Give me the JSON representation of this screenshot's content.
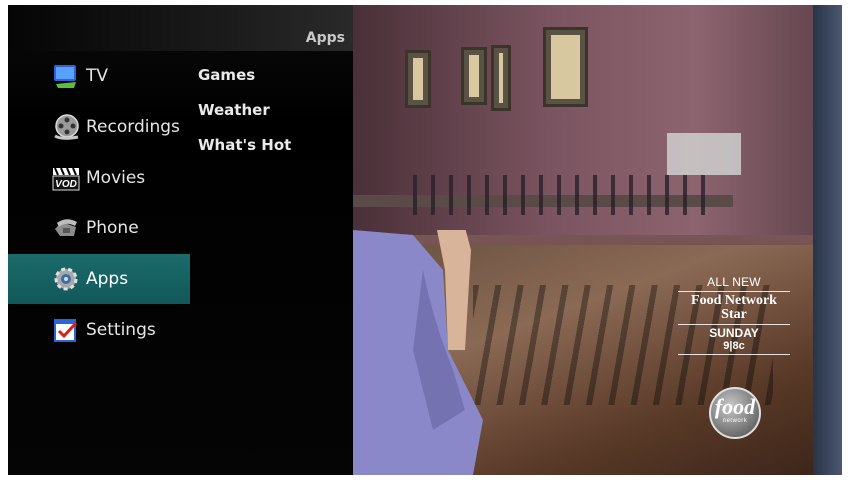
{
  "menu": {
    "section_title": "Apps",
    "items": [
      {
        "label": "TV",
        "icon": "tv-icon"
      },
      {
        "label": "Recordings",
        "icon": "film-reel-icon"
      },
      {
        "label": "Movies",
        "icon": "vod-clapper-icon"
      },
      {
        "label": "Phone",
        "icon": "phone-icon"
      },
      {
        "label": "Apps",
        "icon": "gear-icon",
        "selected": true
      },
      {
        "label": "Settings",
        "icon": "checklist-icon"
      }
    ],
    "submenu": [
      {
        "label": "Games"
      },
      {
        "label": "Weather"
      },
      {
        "label": "What's Hot"
      }
    ],
    "vod_badge": "VOD"
  },
  "promo": {
    "line1": "ALL NEW",
    "show_line1": "Food Network",
    "show_line2": "Star",
    "day": "SUNDAY",
    "time": "9|8c",
    "logo_main": "food",
    "logo_sub": "network"
  },
  "colors": {
    "selected_bg": "#1b6b6b",
    "panel_bg": "#000000",
    "text": "#e6e6e6"
  }
}
